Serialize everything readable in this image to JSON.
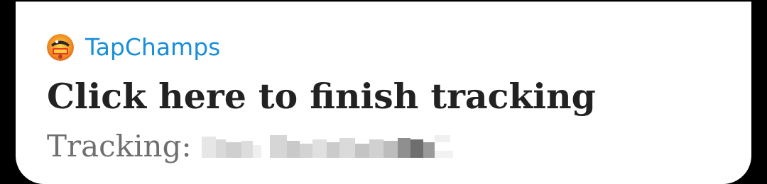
{
  "notification": {
    "app_name": "TapChamps",
    "app_icon": "tapchamps-logo-icon",
    "title": "Click here to finish tracking",
    "subtitle_label": "Tracking:",
    "accent_color": "#1a8fd8",
    "redacted": true
  }
}
